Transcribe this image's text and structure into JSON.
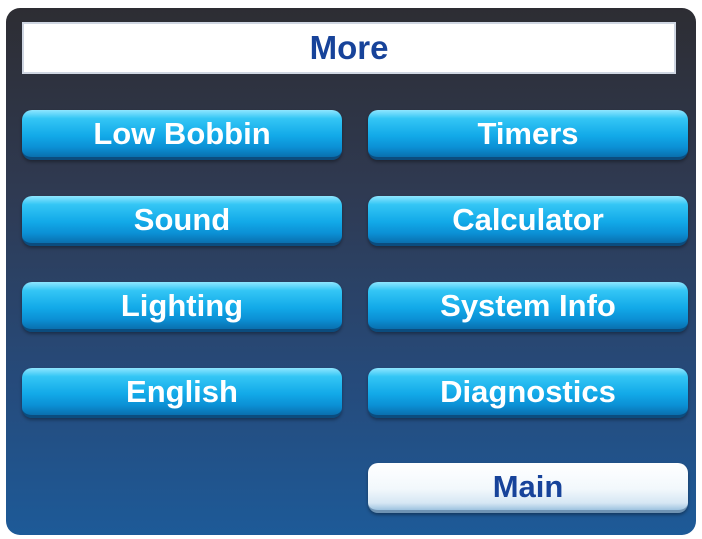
{
  "header": {
    "title": "More"
  },
  "buttons": {
    "low_bobbin": "Low Bobbin",
    "timers": "Timers",
    "sound": "Sound",
    "calculator": "Calculator",
    "lighting": "Lighting",
    "system_info": "System Info",
    "language": "English",
    "diagnostics": "Diagnostics",
    "main": "Main"
  },
  "colors": {
    "title_text": "#17439a",
    "button_blue": "#12a9e8",
    "button_main": "#ffffff",
    "background_top": "#2d2d33",
    "background_bottom": "#1d5a98"
  }
}
